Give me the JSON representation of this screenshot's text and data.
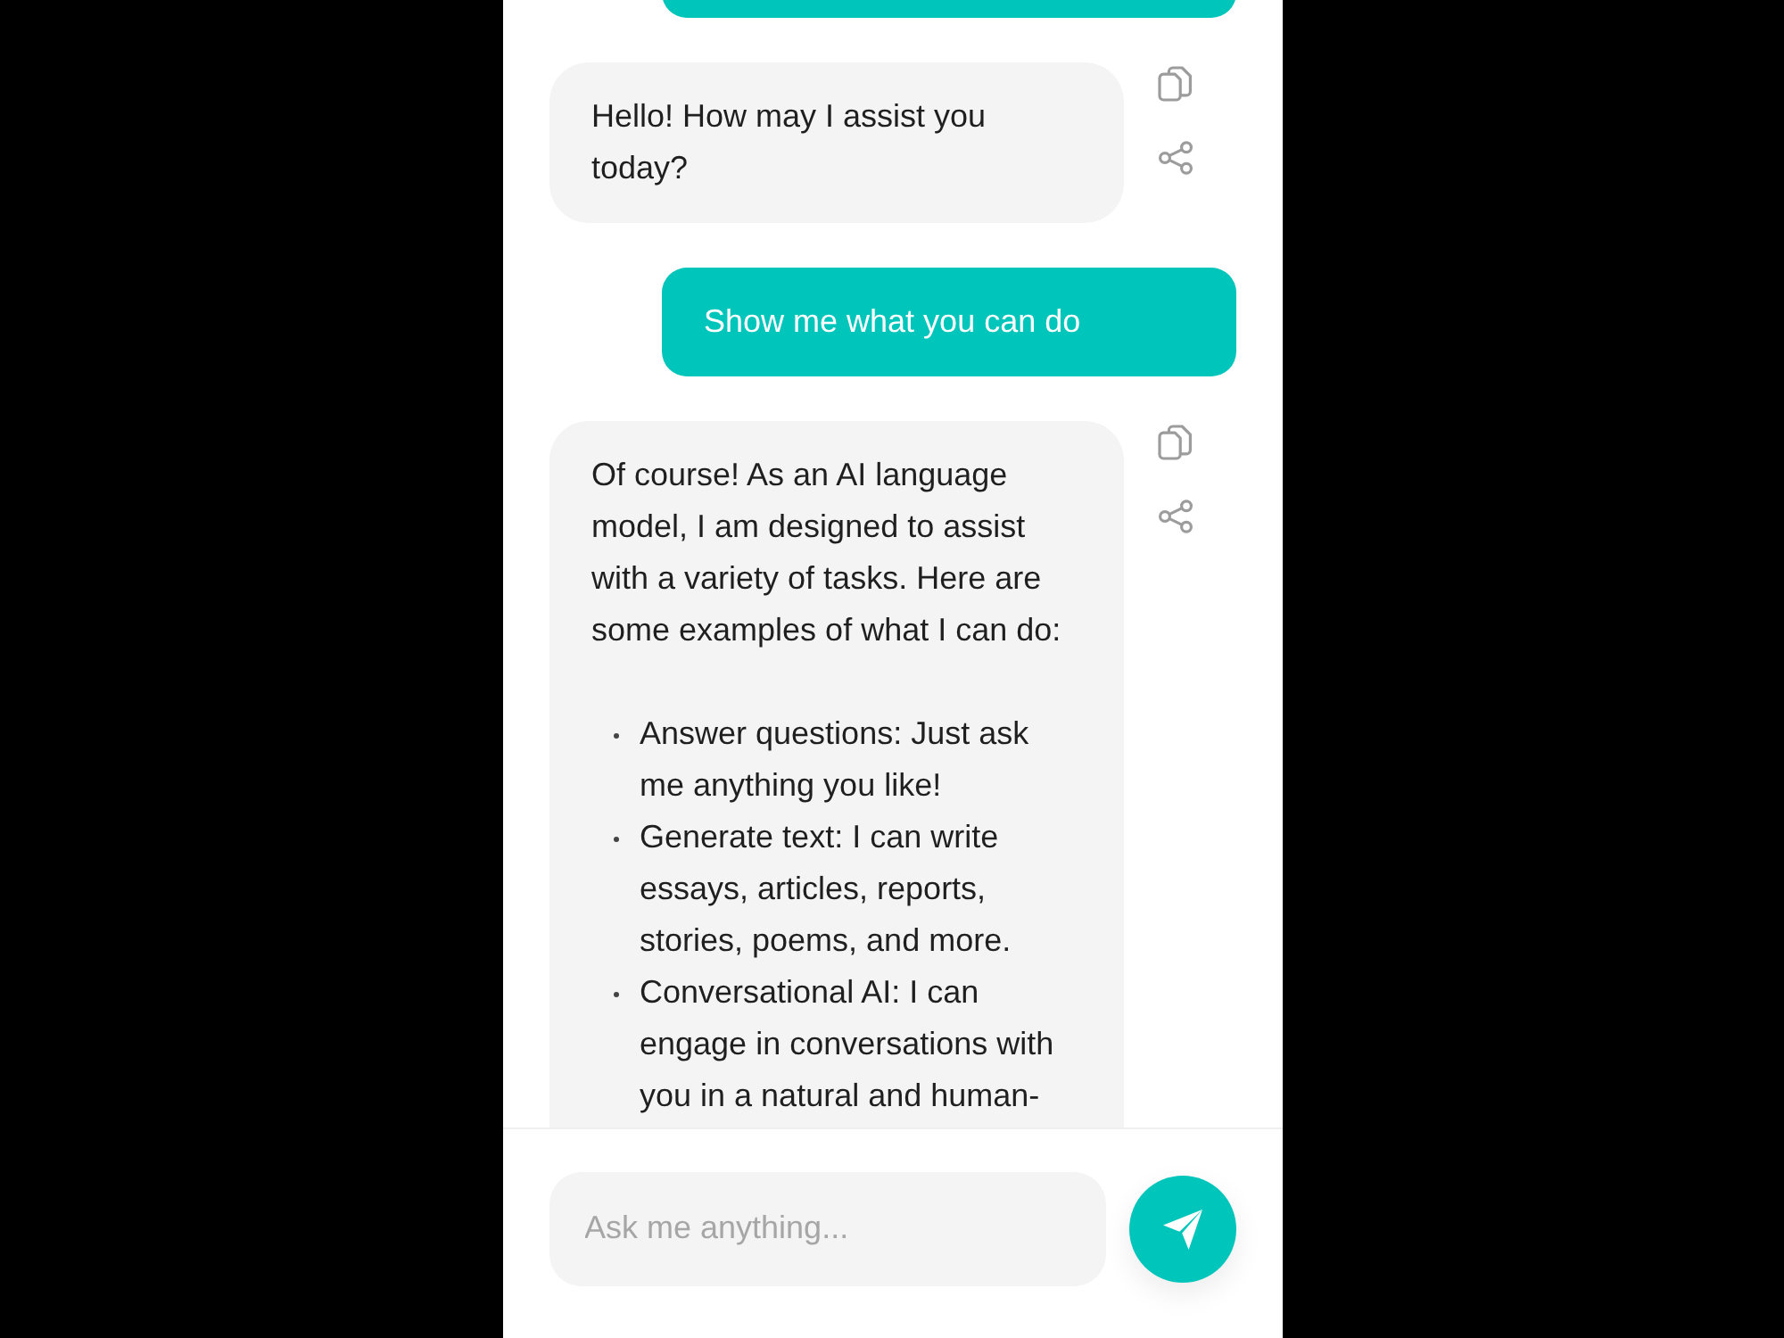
{
  "messages": [
    {
      "kind": "user"
    },
    {
      "kind": "assistant",
      "text": "Hello! How may I assist you today?"
    },
    {
      "kind": "user",
      "text": "Show me what you can do"
    },
    {
      "kind": "assistant",
      "text": "Of course! As an AI language model, I am designed to assist with a variety of tasks. Here are some examples of what I can do:",
      "list": [
        "Answer questions: Just ask me anything you like!",
        "Generate text: I can write essays, articles, reports, stories, poems, and more.",
        "Conversational AI: I can engage in conversations with you in a natural and human-"
      ]
    }
  ],
  "composer": {
    "placeholder": "Ask me anything..."
  }
}
